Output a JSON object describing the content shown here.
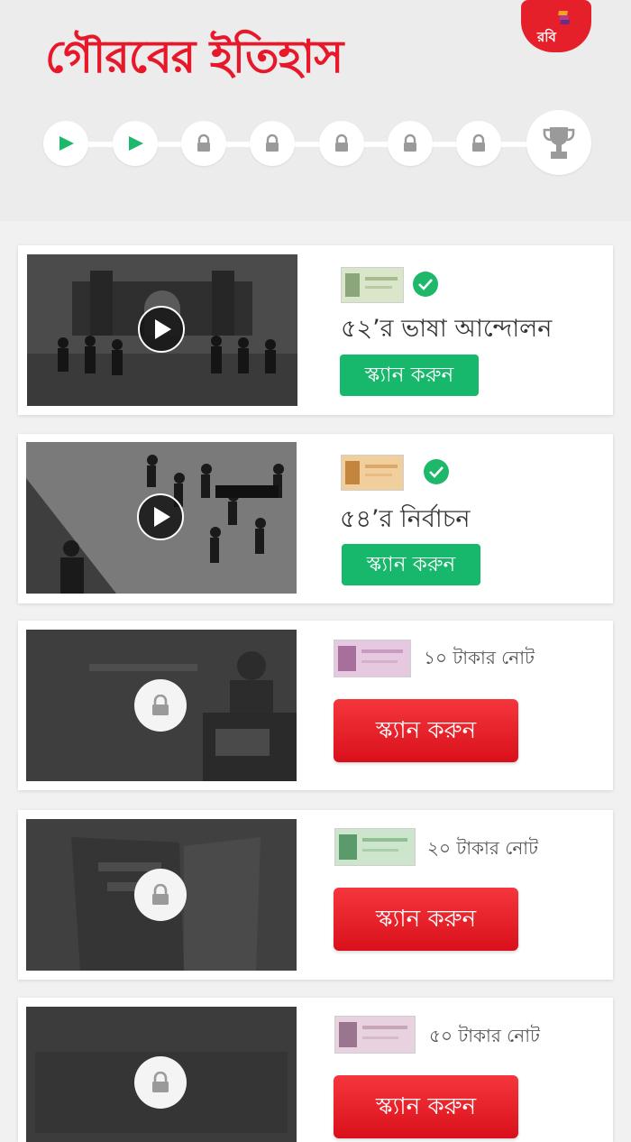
{
  "app": {
    "title": "গৌরবের ইতিহাস",
    "brand_label": "রবি"
  },
  "progress": {
    "steps": [
      "played",
      "played",
      "locked",
      "locked",
      "locked",
      "locked",
      "locked"
    ],
    "final": "trophy"
  },
  "cards": [
    {
      "title": "৫২’র ভাষা আন্দোলন",
      "status": "unlocked",
      "completed": true,
      "button": "স্ক্যান করুন"
    },
    {
      "title": "৫৪’র নির্বাচন",
      "status": "unlocked",
      "completed": true,
      "button": "স্ক্যান করুন"
    },
    {
      "note_label": "১০ টাকার নোট",
      "status": "locked",
      "button": "স্ক্যান করুন"
    },
    {
      "note_label": "২০ টাকার নোট",
      "status": "locked",
      "button": "স্ক্যান করুন"
    },
    {
      "note_label": "৫০ টাকার নোট",
      "status": "locked",
      "button": "স্ক্যান করুন"
    }
  ],
  "colors": {
    "brand_red": "#e8182b",
    "accent_green": "#17b86b",
    "button_red": "#e5202a"
  }
}
